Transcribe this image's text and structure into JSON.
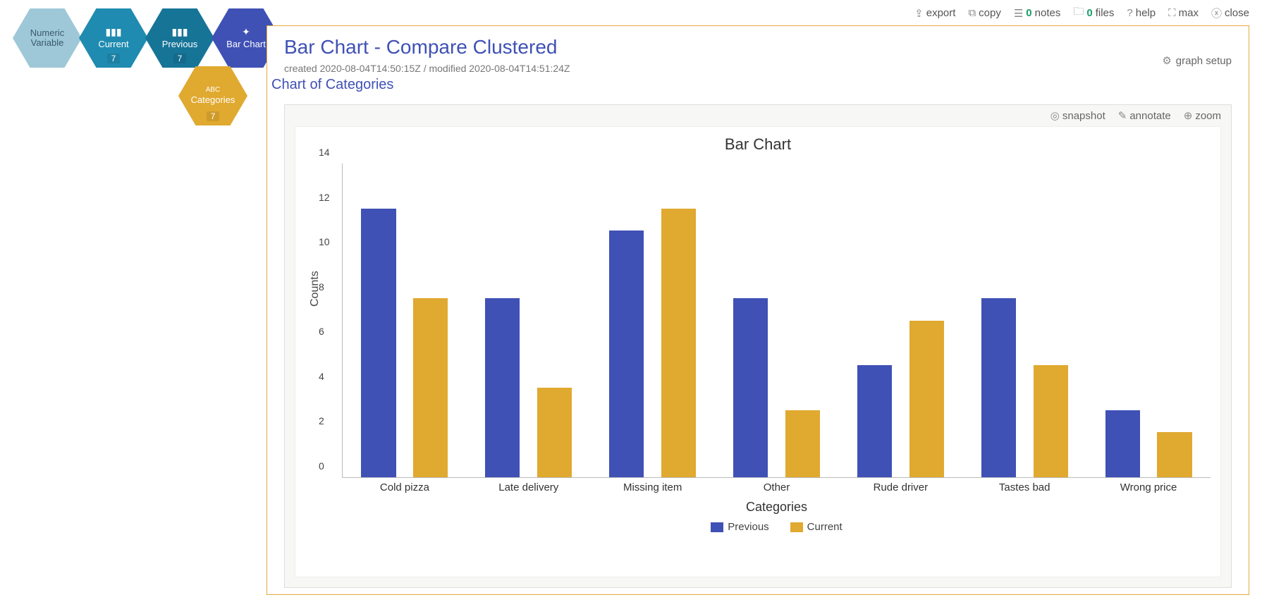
{
  "hexes": {
    "numeric": {
      "label": "Numeric\nVariable"
    },
    "current": {
      "label": "Current",
      "badge": "7"
    },
    "previous": {
      "label": "Previous",
      "badge": "7"
    },
    "barchart": {
      "label": "Bar Chart"
    },
    "categories": {
      "top": "ABC",
      "label": "Categories",
      "badge": "7"
    }
  },
  "toolbar": {
    "export": "export",
    "copy": "copy",
    "notes_count": "0",
    "notes": "notes",
    "files_count": "0",
    "files": "files",
    "help": "help",
    "max": "max",
    "close": "close"
  },
  "header": {
    "title": "Bar Chart - Compare Clustered",
    "timestamps": "created 2020-08-04T14:50:15Z / modified 2020-08-04T14:51:24Z",
    "graph_setup": "graph setup"
  },
  "section_title": "Chart of Categories",
  "chart_toolbar": {
    "snapshot": "snapshot",
    "annotate": "annotate",
    "zoom": "zoom"
  },
  "chart_data": {
    "type": "bar",
    "title": "Bar Chart",
    "xlabel": "Categories",
    "ylabel": "Counts",
    "ylim": [
      0,
      14
    ],
    "yticks": [
      0,
      2,
      4,
      6,
      8,
      10,
      12,
      14
    ],
    "categories": [
      "Cold pizza",
      "Late delivery",
      "Missing item",
      "Other",
      "Rude driver",
      "Tastes bad",
      "Wrong price"
    ],
    "series": [
      {
        "name": "Previous",
        "color": "#3f51b5",
        "values": [
          12,
          8,
          11,
          8,
          5,
          8,
          3
        ]
      },
      {
        "name": "Current",
        "color": "#e0a92f",
        "values": [
          8,
          4,
          12,
          3,
          7,
          5,
          2
        ]
      }
    ]
  }
}
